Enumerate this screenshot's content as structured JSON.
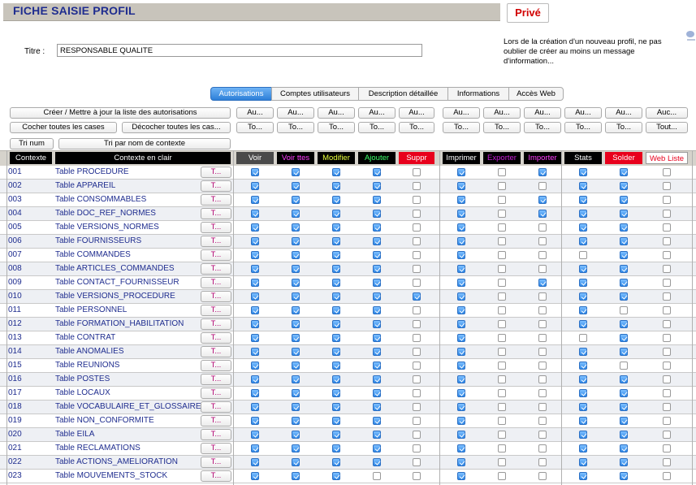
{
  "header": {
    "title": "FICHE SAISIE PROFIL",
    "prive_label": "Privé"
  },
  "titre": {
    "label": "Titre :",
    "value": "RESPONSABLE QUALITE"
  },
  "info_note": "Lors de la création d'un nouveau profil, ne pas oublier de créer au moins un message d'information...",
  "tabs": [
    "Autorisations",
    "Comptes utilisateurs",
    "Description détaillée",
    "Informations",
    "Accès Web"
  ],
  "left_buttons": {
    "creer": "Créer / Mettre à jour la liste des autorisations",
    "cocher": "Cocher toutes les cases",
    "decocher": "Décocher toutes les cas...",
    "tri_num": "Tri num",
    "tri_nom": "Tri par nom de contexte"
  },
  "col_buttons": {
    "top": [
      "Au...",
      "Au...",
      "Au...",
      "Au...",
      "Au...",
      "Au...",
      "Au...",
      "Au...",
      "Au...",
      "Au...",
      "Auc..."
    ],
    "bottom": [
      "To...",
      "To...",
      "To...",
      "To...",
      "To...",
      "To...",
      "To...",
      "To...",
      "To...",
      "To...",
      "Tout..."
    ]
  },
  "columns": {
    "contexte": "Contexte",
    "contexte_clair": "Contexte en clair",
    "perms": [
      {
        "label": "Voir",
        "bg": "#4a4a4a",
        "fg": "#ffffff"
      },
      {
        "label": "Voir ttes",
        "bg": "#000000",
        "fg": "#ff3cff"
      },
      {
        "label": "Modifier",
        "bg": "#000000",
        "fg": "#e8ff3c"
      },
      {
        "label": "Ajouter",
        "bg": "#000000",
        "fg": "#3cff6a"
      },
      {
        "label": "Suppr",
        "bg": "#e8001c",
        "fg": "#ffffff"
      },
      {
        "label": "Imprimer",
        "bg": "#000000",
        "fg": "#ffffff"
      },
      {
        "label": "Exporter",
        "bg": "#000000",
        "fg": "#c81ed8"
      },
      {
        "label": "Importer",
        "bg": "#000000",
        "fg": "#ff3cff"
      },
      {
        "label": "Stats",
        "bg": "#000000",
        "fg": "#ffffff"
      },
      {
        "label": "Solder",
        "bg": "#e8001c",
        "fg": "#ffffff"
      },
      {
        "label": "Web Liste",
        "bg": "#ffffff",
        "fg": "#e8001c"
      }
    ]
  },
  "row_button_label": "T...",
  "rows": [
    {
      "code": "001",
      "name": "Table PROCEDURE",
      "perms": [
        1,
        1,
        1,
        1,
        0,
        1,
        0,
        1,
        1,
        1,
        0
      ]
    },
    {
      "code": "002",
      "name": "Table APPAREIL",
      "perms": [
        1,
        1,
        1,
        1,
        0,
        1,
        0,
        0,
        1,
        1,
        0
      ]
    },
    {
      "code": "003",
      "name": "Table CONSOMMABLES",
      "perms": [
        1,
        1,
        1,
        1,
        0,
        1,
        0,
        1,
        1,
        1,
        0
      ]
    },
    {
      "code": "004",
      "name": "Table DOC_REF_NORMES",
      "perms": [
        1,
        1,
        1,
        1,
        0,
        1,
        0,
        1,
        1,
        1,
        0
      ]
    },
    {
      "code": "005",
      "name": "Table VERSIONS_NORMES",
      "perms": [
        1,
        1,
        1,
        1,
        0,
        1,
        0,
        0,
        1,
        1,
        0
      ]
    },
    {
      "code": "006",
      "name": "Table FOURNISSEURS",
      "perms": [
        1,
        1,
        1,
        1,
        0,
        1,
        0,
        0,
        1,
        1,
        0
      ]
    },
    {
      "code": "007",
      "name": "Table COMMANDES",
      "perms": [
        1,
        1,
        1,
        1,
        0,
        1,
        0,
        0,
        0,
        1,
        0
      ]
    },
    {
      "code": "008",
      "name": "Table ARTICLES_COMMANDES",
      "perms": [
        1,
        1,
        1,
        1,
        0,
        1,
        0,
        0,
        1,
        1,
        0
      ]
    },
    {
      "code": "009",
      "name": "Table CONTACT_FOURNISSEUR",
      "perms": [
        1,
        1,
        1,
        1,
        0,
        1,
        0,
        1,
        1,
        1,
        0
      ]
    },
    {
      "code": "010",
      "name": "Table VERSIONS_PROCEDURE",
      "perms": [
        1,
        1,
        1,
        1,
        1,
        1,
        0,
        0,
        1,
        1,
        0
      ]
    },
    {
      "code": "011",
      "name": "Table PERSONNEL",
      "perms": [
        1,
        1,
        1,
        1,
        0,
        1,
        0,
        0,
        1,
        0,
        0
      ]
    },
    {
      "code": "012",
      "name": "Table FORMATION_HABILITATION",
      "perms": [
        1,
        1,
        1,
        1,
        0,
        1,
        0,
        0,
        1,
        1,
        0
      ]
    },
    {
      "code": "013",
      "name": "Table CONTRAT",
      "perms": [
        1,
        1,
        1,
        1,
        0,
        1,
        0,
        0,
        0,
        1,
        0
      ]
    },
    {
      "code": "014",
      "name": "Table ANOMALIES",
      "perms": [
        1,
        1,
        1,
        1,
        0,
        1,
        0,
        0,
        1,
        1,
        0
      ]
    },
    {
      "code": "015",
      "name": "Table REUNIONS",
      "perms": [
        1,
        1,
        1,
        1,
        0,
        1,
        0,
        0,
        1,
        0,
        0
      ]
    },
    {
      "code": "016",
      "name": "Table POSTES",
      "perms": [
        1,
        1,
        1,
        1,
        0,
        1,
        0,
        0,
        1,
        1,
        0
      ]
    },
    {
      "code": "017",
      "name": "Table LOCAUX",
      "perms": [
        1,
        1,
        1,
        1,
        0,
        1,
        0,
        0,
        1,
        1,
        0
      ]
    },
    {
      "code": "018",
      "name": "Table VOCABULAIRE_ET_GLOSSAIRE",
      "perms": [
        1,
        1,
        1,
        1,
        0,
        1,
        0,
        0,
        1,
        1,
        0
      ]
    },
    {
      "code": "019",
      "name": "Table NON_CONFORMITE",
      "perms": [
        1,
        1,
        1,
        1,
        0,
        1,
        0,
        0,
        1,
        1,
        0
      ]
    },
    {
      "code": "020",
      "name": "Table EILA",
      "perms": [
        1,
        1,
        1,
        1,
        0,
        1,
        0,
        0,
        1,
        1,
        0
      ]
    },
    {
      "code": "021",
      "name": "Table RECLAMATIONS",
      "perms": [
        1,
        1,
        1,
        1,
        0,
        1,
        0,
        0,
        1,
        1,
        0
      ]
    },
    {
      "code": "022",
      "name": "Table ACTIONS_AMELIORATION",
      "perms": [
        1,
        1,
        1,
        1,
        0,
        1,
        0,
        0,
        1,
        1,
        0
      ]
    },
    {
      "code": "023",
      "name": "Table MOUVEMENTS_STOCK",
      "perms": [
        1,
        1,
        1,
        0,
        0,
        1,
        0,
        0,
        1,
        1,
        0
      ]
    }
  ]
}
